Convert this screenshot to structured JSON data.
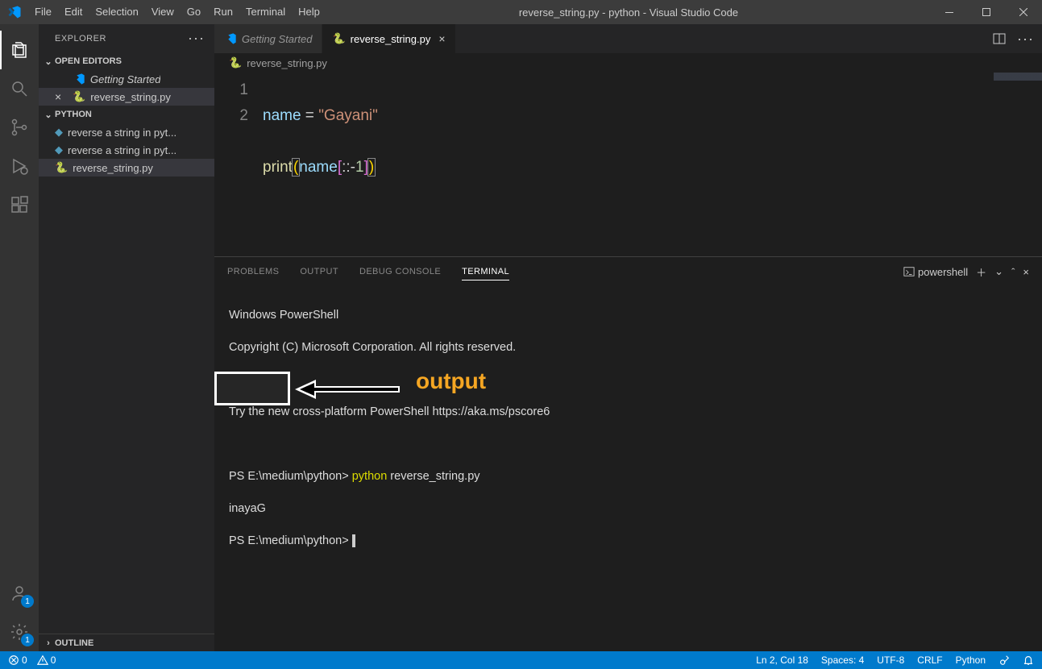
{
  "titlebar": {
    "menus": [
      "File",
      "Edit",
      "Selection",
      "View",
      "Go",
      "Run",
      "Terminal",
      "Help"
    ],
    "title": "reverse_string.py - python - Visual Studio Code"
  },
  "sidebar": {
    "header": "EXPLORER",
    "open_editors_label": "OPEN EDITORS",
    "open_editors": [
      {
        "name": "Getting Started",
        "icon": "vscode",
        "italic": true
      },
      {
        "name": "reverse_string.py",
        "icon": "python",
        "active": true
      }
    ],
    "folder_label": "PYTHON",
    "files": [
      {
        "name": "reverse a string in pyt...",
        "icon": "md"
      },
      {
        "name": "reverse a string in pyt...",
        "icon": "md"
      },
      {
        "name": "reverse_string.py",
        "icon": "python",
        "active": true
      }
    ],
    "outline_label": "OUTLINE"
  },
  "tabs": [
    {
      "label": "Getting Started",
      "icon": "vscode",
      "italic": true,
      "active": false
    },
    {
      "label": "reverse_string.py",
      "icon": "python",
      "italic": false,
      "active": true
    }
  ],
  "breadcrumb": {
    "file": "reverse_string.py"
  },
  "code": {
    "line1": {
      "var": "name",
      "eq": " = ",
      "str": "\"Gayani\""
    },
    "line2": {
      "fn": "print",
      "lp": "(",
      "var": "name",
      "lb": "[",
      "slice": "::",
      "neg": "-",
      "num": "1",
      "rb": "]",
      "rp": ")"
    }
  },
  "panel": {
    "tabs": [
      "PROBLEMS",
      "OUTPUT",
      "DEBUG CONSOLE",
      "TERMINAL"
    ],
    "active": 3,
    "shell_label": "powershell"
  },
  "terminal": {
    "l1": "Windows PowerShell",
    "l2": "Copyright (C) Microsoft Corporation. All rights reserved.",
    "l3": "Try the new cross-platform PowerShell https://aka.ms/pscore6",
    "prompt1_pre": "PS E:\\medium\\python> ",
    "cmd_part1": "python",
    "cmd_part2": " reverse_string.py",
    "output": "inayaG",
    "prompt2": "PS E:\\medium\\python> ",
    "annotation": "output"
  },
  "status": {
    "errors": "0",
    "warnings": "0",
    "lncol": "Ln 2, Col 18",
    "spaces": "Spaces: 4",
    "enc": "UTF-8",
    "eol": "CRLF",
    "lang": "Python"
  },
  "badges": {
    "accounts": "1",
    "settings": "1"
  }
}
